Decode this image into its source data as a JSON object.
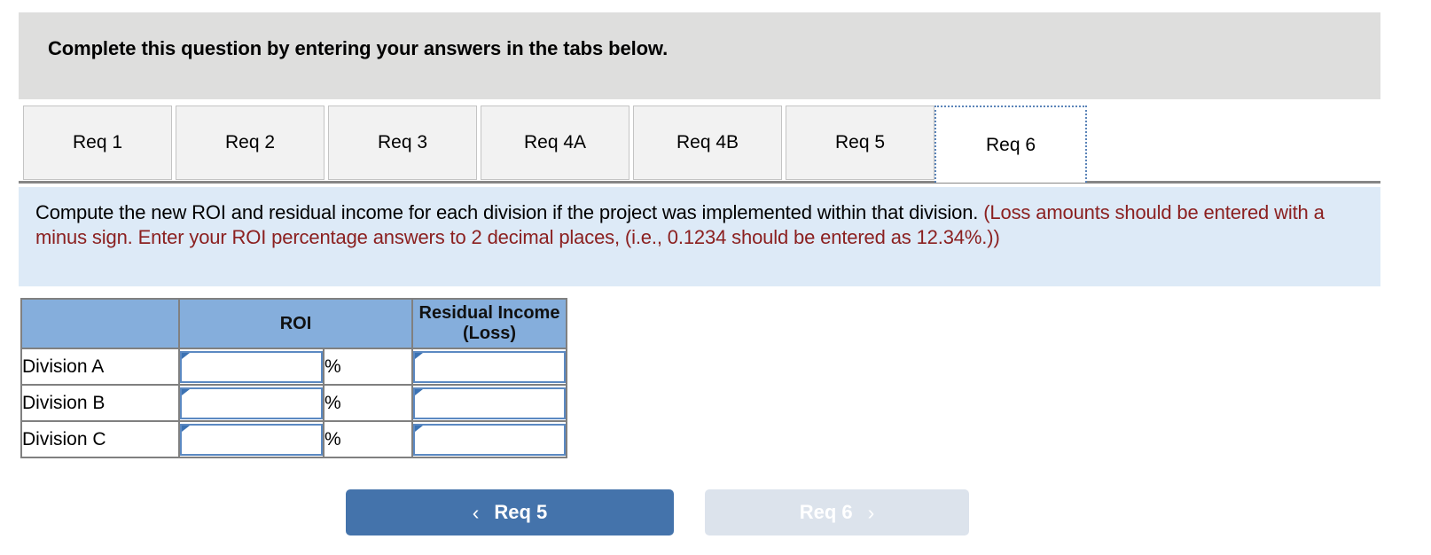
{
  "header": {
    "instruction": "Complete this question by entering your answers in the tabs below."
  },
  "tabs": {
    "items": [
      {
        "label": "Req 1",
        "active": false
      },
      {
        "label": "Req 2",
        "active": false
      },
      {
        "label": "Req 3",
        "active": false
      },
      {
        "label": "Req 4A",
        "active": false
      },
      {
        "label": "Req 4B",
        "active": false
      },
      {
        "label": "Req 5",
        "active": false
      },
      {
        "label": "Req 6",
        "active": true
      }
    ]
  },
  "requirement": {
    "prompt": "Compute the new ROI and residual income for each division if the project was implemented within that division. ",
    "hint": "(Loss amounts should be entered with a minus sign. Enter your ROI percentage answers to 2 decimal places, (i.e., 0.1234 should be entered as 12.34%.))"
  },
  "table": {
    "headers": {
      "blank": "",
      "roi": "ROI",
      "residual_income": "Residual Income (Loss)"
    },
    "percent_symbol": "%",
    "rows": [
      {
        "label": "Division A",
        "roi_value": "",
        "percent": "%",
        "residual_income_value": ""
      },
      {
        "label": "Division B",
        "roi_value": "",
        "percent": "%",
        "residual_income_value": ""
      },
      {
        "label": "Division C",
        "roi_value": "",
        "percent": "%",
        "residual_income_value": ""
      }
    ]
  },
  "navigation": {
    "prev_label": "Req 5",
    "prev_chevron": "‹",
    "next_label": "Req 6",
    "next_chevron": "›"
  },
  "colors": {
    "header_bg": "#dededd",
    "panel_bg": "#ddeaf7",
    "hint_text": "#8b2020",
    "table_header_bg": "#85aedc",
    "input_border": "#5b89c2",
    "prev_button": "#4473ab",
    "next_button": "#dce3ec",
    "tab_active_border": "#5b84b8"
  }
}
